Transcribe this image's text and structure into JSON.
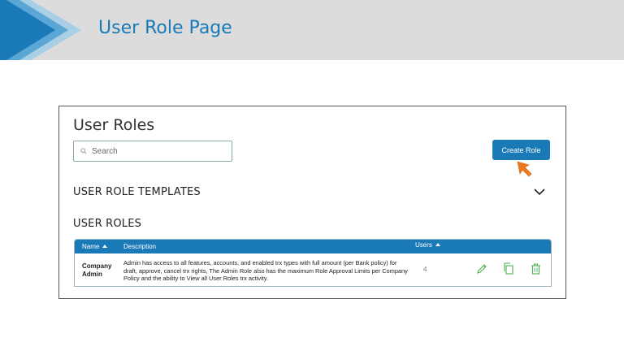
{
  "slide": {
    "title": "User Role Page"
  },
  "panel": {
    "title": "User Roles",
    "search_placeholder": "Search",
    "create_button_label": "Create Role"
  },
  "templates_section": {
    "title": "USER ROLE TEMPLATES",
    "expand_icon": "chevron-down-icon"
  },
  "roles_section": {
    "title": "USER ROLES",
    "columns": [
      "Name",
      "Description",
      "Users"
    ],
    "rows": [
      {
        "name_line1": "Company",
        "name_line2": "Admin",
        "description": "Admin has access to all features, accounts, and enabled trx types with full amount (per Bank policy) for draft, approve, cancel trx rights, The Admin Role also has the maximum Role Approval Limits per Company Policy and the ability to View all User Roles trx activity.",
        "users": "4",
        "actions": [
          "edit-icon",
          "copy-icon",
          "delete-icon"
        ]
      }
    ]
  },
  "colors": {
    "accent": "#1a7ab8",
    "action_icons": "#4caf50",
    "cursor": "#f07a1a",
    "header_bg": "#dcdcdc"
  }
}
